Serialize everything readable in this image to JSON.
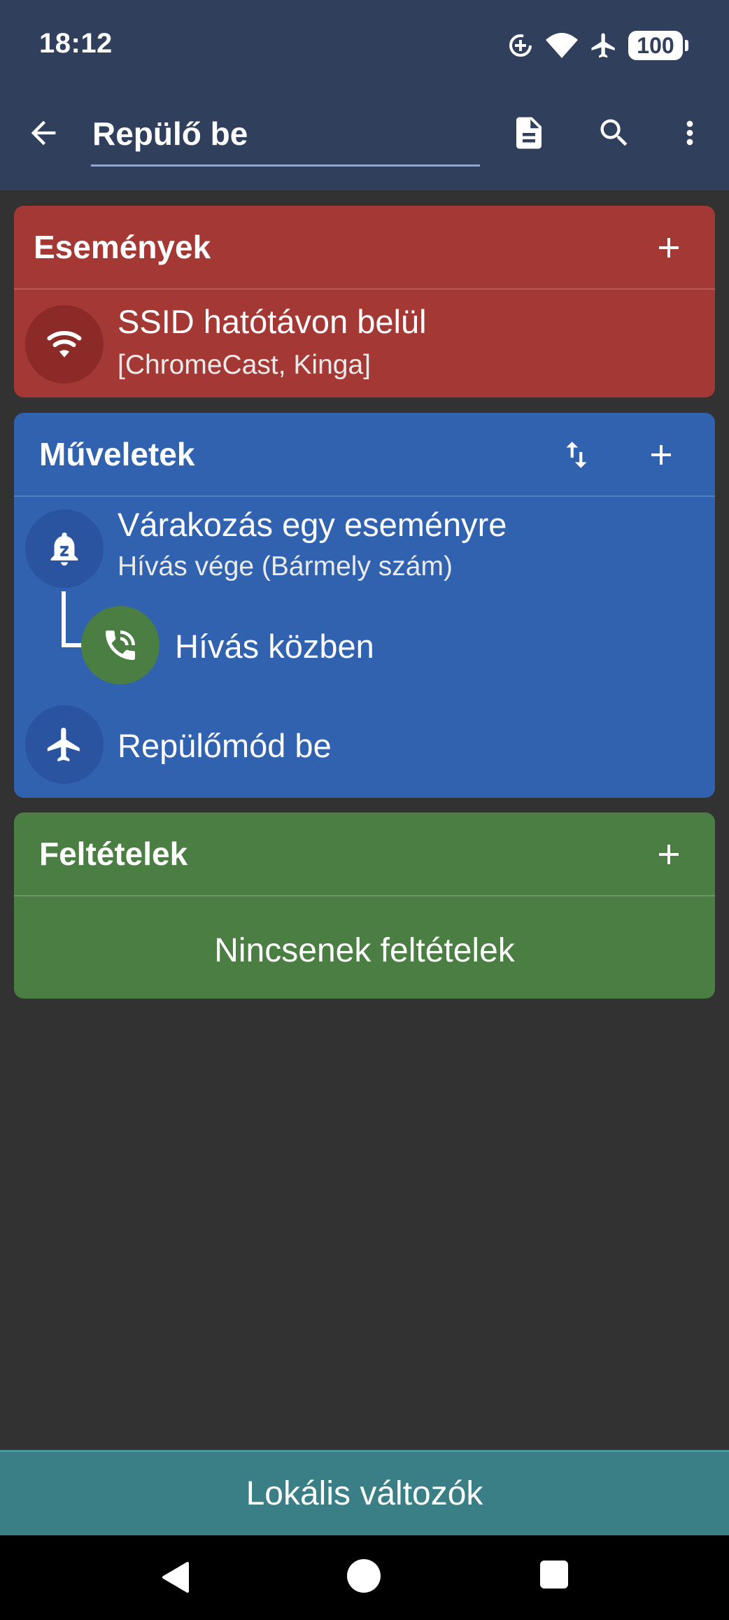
{
  "status_bar": {
    "time": "18:12",
    "battery": "100",
    "icons": [
      "data-saver-icon",
      "wifi-icon",
      "airplane-icon",
      "battery-icon"
    ]
  },
  "toolbar": {
    "title": "Repülő be",
    "icons": [
      "arrow-back-icon",
      "document-icon",
      "search-icon",
      "more-vert-icon"
    ]
  },
  "events": {
    "title": "Események",
    "items": [
      {
        "title": "SSID hatótávon belül",
        "subtitle": "[ChromeCast, Kinga]",
        "icon": "wifi-icon"
      }
    ]
  },
  "actions": {
    "title": "Műveletek",
    "items": [
      {
        "title": "Várakozás egy eseményre",
        "subtitle": "Hívás vége (Bármely szám)",
        "icon": "snooze-bell-icon"
      },
      {
        "title": "Hívás közben",
        "icon": "phone-in-talk-icon"
      },
      {
        "title": "Repülőmód be",
        "icon": "airplane-icon"
      }
    ]
  },
  "conditions": {
    "title": "Feltételek",
    "empty": "Nincsenek feltételek"
  },
  "bottom_bar": {
    "label": "Lokális változók"
  },
  "colors": {
    "appbar": "#2f3f5c",
    "background": "#323232",
    "events": "#a43834",
    "actions": "#3062b0",
    "conditions": "#4b7e42",
    "bottom_bar": "#3a7f86"
  }
}
